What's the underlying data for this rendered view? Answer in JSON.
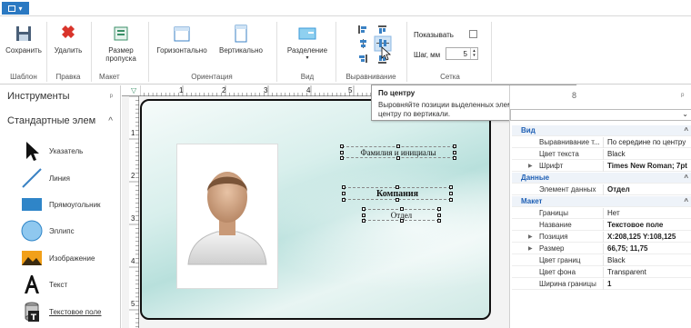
{
  "ribbon": {
    "buttons": {
      "save": "Сохранить",
      "delete": "Удалить",
      "page_size": "Размер пропуска",
      "horizontal": "Горизонтально",
      "vertical": "Вертикально",
      "divider": "Разделение"
    },
    "groups": {
      "template": "Шаблон",
      "edit": "Правка",
      "layout": "Макет",
      "orientation": "Ориентация",
      "view": "Вид",
      "align": "Выравнивание",
      "grid": "Сетка"
    },
    "grid": {
      "show_label": "Показывать",
      "step_label": "Шаг, мм",
      "step_value": "5"
    }
  },
  "tools": {
    "title": "Инструменты",
    "pin": "ᵖ",
    "category": "Стандартные элем",
    "items": [
      {
        "label": "Указатель"
      },
      {
        "label": "Линия"
      },
      {
        "label": "Прямоугольник"
      },
      {
        "label": "Эллипс"
      },
      {
        "label": "Изображение"
      },
      {
        "label": "Текст"
      },
      {
        "label": "Текстовое поле"
      }
    ]
  },
  "rulers": {
    "h_numbers": [
      "1",
      "2",
      "3",
      "4",
      "5"
    ],
    "v_numbers": [
      "1",
      "2",
      "3",
      "4",
      "5"
    ]
  },
  "card": {
    "name_field": "Фамилия и инициалы",
    "company_field": "Компания",
    "dept_field": "Отдел"
  },
  "tooltip": {
    "title": "По центру",
    "body": "Выровняйте позиции выделенных элементов отчёта по центру по вертикали."
  },
  "properties": {
    "rows": [
      {
        "type": "cat",
        "k": "Вид"
      },
      {
        "type": "prop",
        "k": "Выравнивание т...",
        "v": "По середине по центру"
      },
      {
        "type": "prop",
        "k": "Цвет текста",
        "v": "Black"
      },
      {
        "type": "prop",
        "k": "Шрифт",
        "v": "Times New Roman; 7pt",
        "bold": true,
        "expand": true
      },
      {
        "type": "cat",
        "k": "Данные"
      },
      {
        "type": "prop",
        "k": "Элемент данных",
        "v": "Отдел",
        "bold": true
      },
      {
        "type": "cat",
        "k": "Макет"
      },
      {
        "type": "prop",
        "k": "Границы",
        "v": "Нет"
      },
      {
        "type": "prop",
        "k": "Название",
        "v": "Текстовое поле",
        "bold": true
      },
      {
        "type": "prop",
        "k": "Позиция",
        "v": "X:208,125 Y:108,125",
        "bold": true,
        "expand": true
      },
      {
        "type": "prop",
        "k": "Размер",
        "v": "66,75; 11,75",
        "bold": true,
        "expand": true
      },
      {
        "type": "prop",
        "k": "Цвет границ",
        "v": "Black"
      },
      {
        "type": "prop",
        "k": "Цвет фона",
        "v": "Transparent"
      },
      {
        "type": "prop",
        "k": "Ширина границы",
        "v": "1",
        "bold": true
      }
    ]
  },
  "colors": {
    "accent": "#2b79c2",
    "category_text": "#1e5fb4",
    "delete_red": "#d9342b"
  }
}
